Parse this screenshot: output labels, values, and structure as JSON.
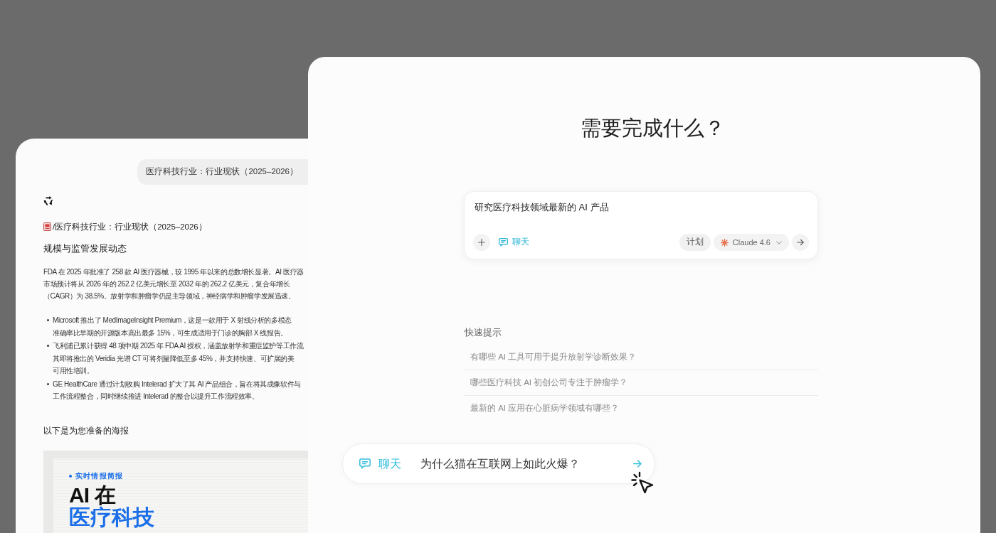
{
  "conversation_window": {
    "user_message": "医疗科技行业：行业现状（2025–2026）",
    "document_title": "/医疗科技行业：行业现状（2025–2026）",
    "section_heading": "规模与监管发展动态",
    "paragraph_lines": [
      "FDA 在 2025 年批准了 258 款 AI 医疗器械，较 1995 年以来的总数增长显著。AI 医疗器",
      "市场预计将从 2026 年的 262.2 亿美元增长至 2032 年的 262.2 亿美元，复合年增长",
      "（CAGR）为 38.5%。放射学和肿瘤学仍是主导领域，神经病学和肿瘤学发展迅速。"
    ],
    "bullets": [
      {
        "lines": [
          "Microsoft 推出了 MedImageInsight Premium，这是一款用于 X 射线分析的多模态",
          "准确率比早期的开源版本高出最多 15%，可生成适用于门诊的胸部 X 线报告。"
        ]
      },
      {
        "lines": [
          "飞利浦已累计获得 48 项中期 2025 年 FDA AI 授权，涵盖放射学和重症监护等工作流",
          "其即将推出的 Veridia 光谱 CT 可将剂量降低至多 45%，并支持快速、可扩展的美",
          "可用性培训。"
        ]
      },
      {
        "lines": [
          "GE HealthCare 通过计划收购 Intelerad 扩大了其 AI 产品组合，旨在将其成像软件与",
          "工作流程整合，同时继续推进 Intelerad 的整合以提升工作流程效率。"
        ]
      }
    ],
    "poster_intro": "以下是为您准备的海报",
    "poster": {
      "tag": "实时情报简报",
      "title": "AI 在",
      "highlight": "医疗科技"
    }
  },
  "prompt_window": {
    "title": "需要完成什么？",
    "prompt_box": {
      "value": "研究医疗科技领域最新的 AI 产品",
      "chat_mode": {
        "label": "聊天",
        "active": true
      },
      "plan_button": "计划",
      "model_selector": "Claude 4.6"
    },
    "quick_tips": {
      "heading": "快速提示",
      "items": [
        "有哪些 AI 工具可用于提升放射学诊断效果？",
        "哪些医疗科技 AI 初创公司专注于肿瘤学？",
        "最新的 AI 应用在心脏病学领域有哪些？"
      ]
    },
    "chat_bar": {
      "mode": "聊天",
      "message": "为什么猫在互联网上如此火爆？"
    }
  }
}
